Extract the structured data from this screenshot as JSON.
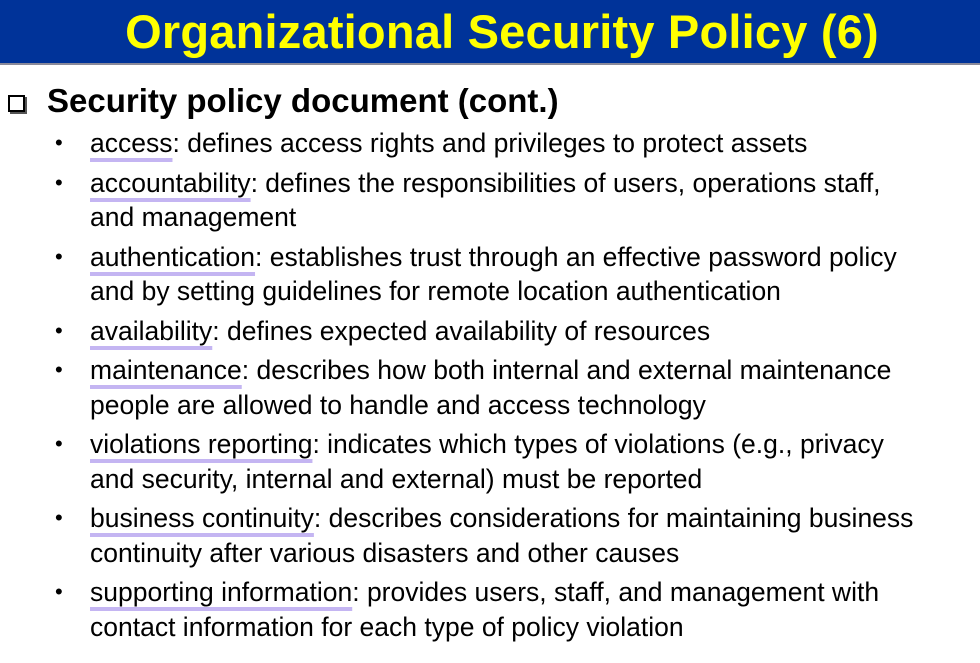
{
  "title": "Organizational Security Policy (6)",
  "heading": "Security policy document (cont.)",
  "items": [
    {
      "term": "access",
      "desc": ": defines access rights and privileges to protect assets",
      "cont": ""
    },
    {
      "term": "accountability",
      "desc": ": defines the responsibilities of users, operations staff,",
      "cont": "and management"
    },
    {
      "term": "authentication",
      "desc": ": establishes trust through an effective password policy",
      "cont": "and by setting guidelines for remote location authentication"
    },
    {
      "term": "availability",
      "desc": ": defines expected availability of resources",
      "cont": ""
    },
    {
      "term": "maintenance",
      "desc": ": describes how both internal and external maintenance",
      "cont": "people are allowed to handle and access technology"
    },
    {
      "term": "violations reporting",
      "desc": ": indicates which types of violations (e.g., privacy",
      "cont": "and security, internal and external) must be reported"
    },
    {
      "term": "business continuity",
      "desc": ": describes considerations for maintaining business",
      "cont": "continuity after various disasters and other causes"
    },
    {
      "term": "supporting information",
      "desc": ": provides users, staff, and management with",
      "cont": "contact information for each type of policy violation"
    }
  ]
}
